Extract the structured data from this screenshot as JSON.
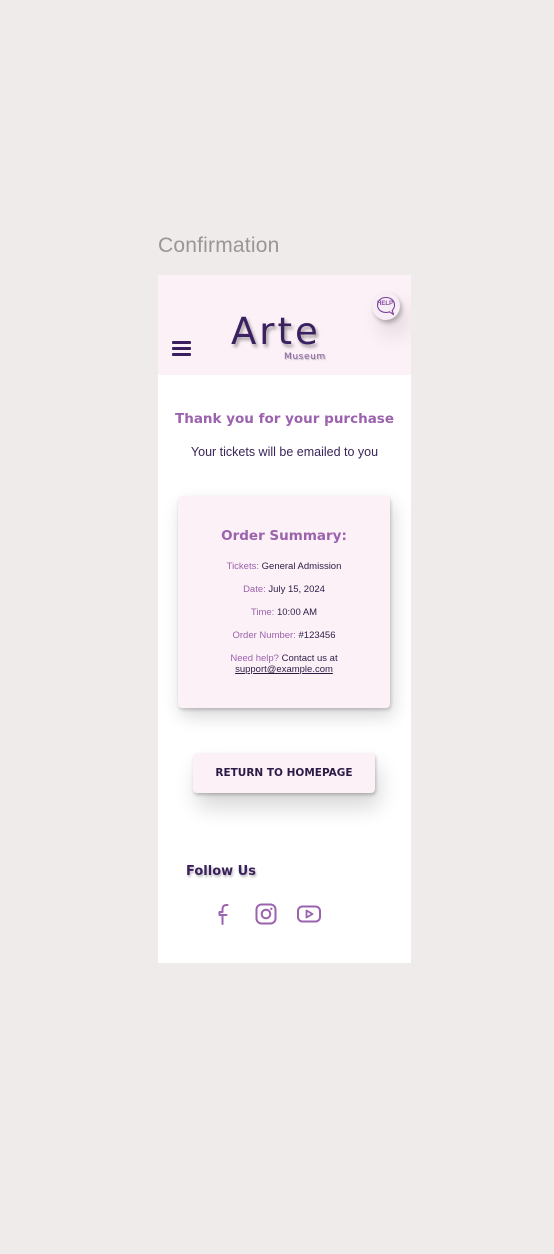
{
  "frame": {
    "title": "Confirmation"
  },
  "header": {
    "logo": "Arte",
    "logo_sub": "Museum",
    "help_label": "HELP",
    "menu_icon": "hamburger-menu-icon"
  },
  "main": {
    "heading": "Thank you for your purchase",
    "subtext": "Your tickets will be emailed to you"
  },
  "summary": {
    "title": "Order Summary:",
    "tickets_label": "Tickets:",
    "tickets_value": "General Admission",
    "date_label": "Date:",
    "date_value": "July 15, 2024",
    "time_label": "Time:",
    "time_value": "10:00 AM",
    "order_label": "Order Number:",
    "order_value": "#123456",
    "help_label": "Need help?",
    "help_text": "Contact us at",
    "help_email": "support@example.com"
  },
  "actions": {
    "return_label": "RETURN TO HOMEPAGE"
  },
  "footer": {
    "follow_title": "Follow Us",
    "social_icons": [
      "facebook-icon",
      "instagram-icon",
      "youtube-icon"
    ]
  },
  "colors": {
    "background": "#efebea",
    "header_bg": "#fbf1f7",
    "accent": "#9b62ad",
    "dark_text": "#3a1f5c"
  }
}
